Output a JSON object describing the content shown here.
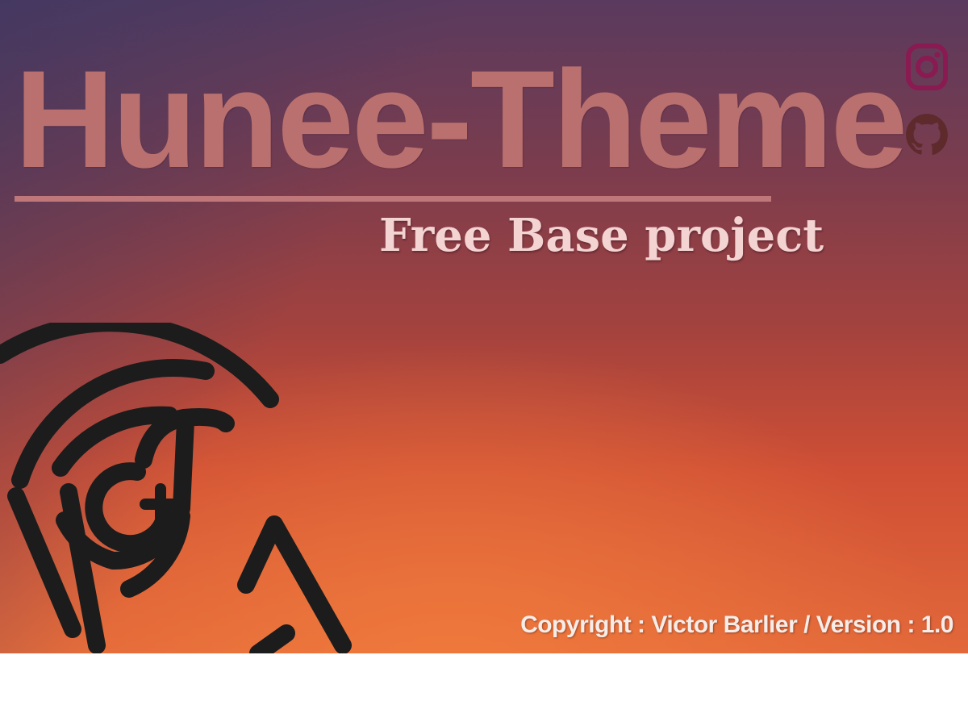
{
  "hero": {
    "title": "Hunee-Theme",
    "subtitle": "Free Base project",
    "copyright": "Copyright : Victor Barlier / Version : 1.0"
  },
  "social": {
    "instagram_icon": "instagram-icon",
    "github_icon": "github-icon"
  },
  "logo": {
    "icon": "hunee-logo-icon"
  },
  "colors": {
    "title": "#b9706f",
    "subtitle": "#f3d4d2",
    "instagram": "#8a1a52",
    "github": "#5e2a2c",
    "logo_stroke": "#1c1c1c",
    "background_top": "#5a3a5e",
    "background_bottom": "#e2683a"
  }
}
